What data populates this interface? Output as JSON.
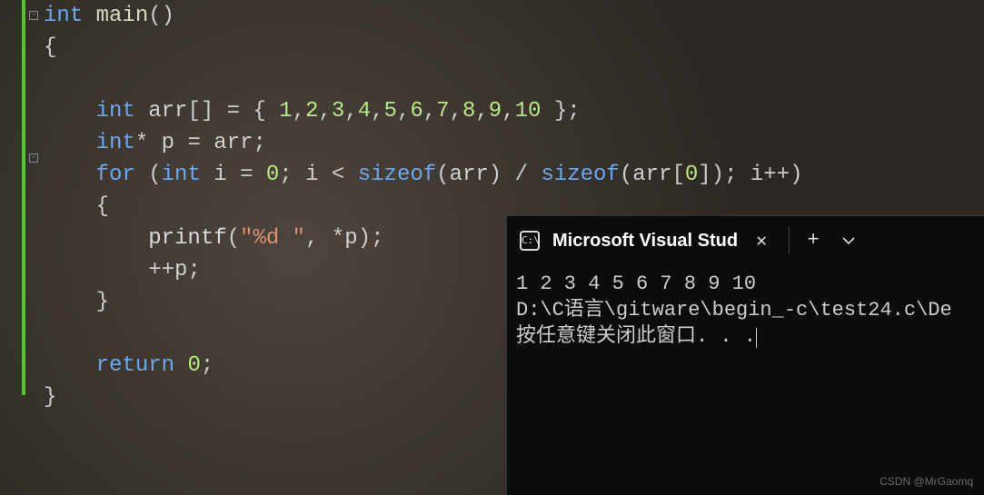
{
  "code": {
    "lines": [
      {
        "indent": "",
        "tokens": [
          {
            "cls": "kw",
            "t": "int"
          },
          {
            "cls": "",
            "t": " "
          },
          {
            "cls": "fn-name",
            "t": "main"
          },
          {
            "cls": "paren",
            "t": "()"
          }
        ]
      },
      {
        "indent": "",
        "tokens": [
          {
            "cls": "brace",
            "t": "{"
          }
        ]
      },
      {
        "indent": "",
        "tokens": []
      },
      {
        "indent": "    ",
        "tokens": [
          {
            "cls": "kw",
            "t": "int"
          },
          {
            "cls": "",
            "t": " "
          },
          {
            "cls": "var",
            "t": "arr"
          },
          {
            "cls": "punct",
            "t": "[]"
          },
          {
            "cls": "",
            "t": " "
          },
          {
            "cls": "op",
            "t": "="
          },
          {
            "cls": "",
            "t": " "
          },
          {
            "cls": "brace",
            "t": "{"
          },
          {
            "cls": "",
            "t": " "
          },
          {
            "cls": "num",
            "t": "1"
          },
          {
            "cls": "punct",
            "t": ","
          },
          {
            "cls": "num",
            "t": "2"
          },
          {
            "cls": "punct",
            "t": ","
          },
          {
            "cls": "num",
            "t": "3"
          },
          {
            "cls": "punct",
            "t": ","
          },
          {
            "cls": "num",
            "t": "4"
          },
          {
            "cls": "punct",
            "t": ","
          },
          {
            "cls": "num",
            "t": "5"
          },
          {
            "cls": "punct",
            "t": ","
          },
          {
            "cls": "num",
            "t": "6"
          },
          {
            "cls": "punct",
            "t": ","
          },
          {
            "cls": "num",
            "t": "7"
          },
          {
            "cls": "punct",
            "t": ","
          },
          {
            "cls": "num",
            "t": "8"
          },
          {
            "cls": "punct",
            "t": ","
          },
          {
            "cls": "num",
            "t": "9"
          },
          {
            "cls": "punct",
            "t": ","
          },
          {
            "cls": "num",
            "t": "10"
          },
          {
            "cls": "",
            "t": " "
          },
          {
            "cls": "brace",
            "t": "}"
          },
          {
            "cls": "punct",
            "t": ";"
          }
        ]
      },
      {
        "indent": "    ",
        "tokens": [
          {
            "cls": "kw",
            "t": "int"
          },
          {
            "cls": "op",
            "t": "*"
          },
          {
            "cls": "",
            "t": " "
          },
          {
            "cls": "var",
            "t": "p"
          },
          {
            "cls": "",
            "t": " "
          },
          {
            "cls": "op",
            "t": "="
          },
          {
            "cls": "",
            "t": " "
          },
          {
            "cls": "var",
            "t": "arr"
          },
          {
            "cls": "punct",
            "t": ";"
          }
        ]
      },
      {
        "indent": "    ",
        "tokens": [
          {
            "cls": "kw",
            "t": "for"
          },
          {
            "cls": "",
            "t": " "
          },
          {
            "cls": "paren",
            "t": "("
          },
          {
            "cls": "kw",
            "t": "int"
          },
          {
            "cls": "",
            "t": " "
          },
          {
            "cls": "var",
            "t": "i"
          },
          {
            "cls": "",
            "t": " "
          },
          {
            "cls": "op",
            "t": "="
          },
          {
            "cls": "",
            "t": " "
          },
          {
            "cls": "num",
            "t": "0"
          },
          {
            "cls": "punct",
            "t": ";"
          },
          {
            "cls": "",
            "t": " "
          },
          {
            "cls": "var",
            "t": "i"
          },
          {
            "cls": "",
            "t": " "
          },
          {
            "cls": "op",
            "t": "<"
          },
          {
            "cls": "",
            "t": " "
          },
          {
            "cls": "szof",
            "t": "sizeof"
          },
          {
            "cls": "paren",
            "t": "("
          },
          {
            "cls": "var",
            "t": "arr"
          },
          {
            "cls": "paren",
            "t": ")"
          },
          {
            "cls": "",
            "t": " "
          },
          {
            "cls": "op",
            "t": "/"
          },
          {
            "cls": "",
            "t": " "
          },
          {
            "cls": "szof",
            "t": "sizeof"
          },
          {
            "cls": "paren",
            "t": "("
          },
          {
            "cls": "var",
            "t": "arr"
          },
          {
            "cls": "punct",
            "t": "["
          },
          {
            "cls": "num",
            "t": "0"
          },
          {
            "cls": "punct",
            "t": "]"
          },
          {
            "cls": "paren",
            "t": ")"
          },
          {
            "cls": "punct",
            "t": ";"
          },
          {
            "cls": "",
            "t": " "
          },
          {
            "cls": "var",
            "t": "i"
          },
          {
            "cls": "op",
            "t": "++"
          },
          {
            "cls": "paren",
            "t": ")"
          }
        ]
      },
      {
        "indent": "    ",
        "tokens": [
          {
            "cls": "brace",
            "t": "{"
          }
        ]
      },
      {
        "indent": "        ",
        "tokens": [
          {
            "cls": "fn-call",
            "t": "printf"
          },
          {
            "cls": "paren",
            "t": "("
          },
          {
            "cls": "str",
            "t": "\"%d \""
          },
          {
            "cls": "punct",
            "t": ","
          },
          {
            "cls": "",
            "t": " "
          },
          {
            "cls": "op",
            "t": "*"
          },
          {
            "cls": "var",
            "t": "p"
          },
          {
            "cls": "paren",
            "t": ")"
          },
          {
            "cls": "punct",
            "t": ";"
          }
        ]
      },
      {
        "indent": "        ",
        "tokens": [
          {
            "cls": "op",
            "t": "++"
          },
          {
            "cls": "var",
            "t": "p"
          },
          {
            "cls": "punct",
            "t": ";"
          }
        ]
      },
      {
        "indent": "    ",
        "tokens": [
          {
            "cls": "brace",
            "t": "}"
          }
        ]
      },
      {
        "indent": "",
        "tokens": []
      },
      {
        "indent": "    ",
        "tokens": [
          {
            "cls": "kw",
            "t": "return"
          },
          {
            "cls": "",
            "t": " "
          },
          {
            "cls": "num",
            "t": "0"
          },
          {
            "cls": "punct",
            "t": ";"
          }
        ]
      },
      {
        "indent": "",
        "tokens": [
          {
            "cls": "brace",
            "t": "}"
          }
        ]
      }
    ]
  },
  "terminal": {
    "tab_title": "Microsoft Visual Stud",
    "output_line1": "1 2 3 4 5 6 7 8 9 10",
    "output_line2": "D:\\C语言\\gitware\\begin_-c\\test24.c\\De",
    "output_line3": "按任意键关闭此窗口. . ."
  },
  "watermark": "CSDN @MrGaomq"
}
